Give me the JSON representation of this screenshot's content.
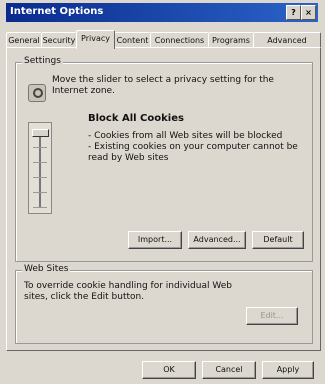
{
  "window": {
    "title": "Internet Options"
  },
  "titlebar_buttons": [
    "?",
    "×"
  ],
  "tabs": [
    "General",
    "Security",
    "Privacy",
    "Content",
    "Connections",
    "Programs",
    "Advanced"
  ],
  "active_tab": "Privacy",
  "settings": {
    "group_label": "Settings",
    "instruction": "Move the slider to select a privacy setting for the Internet zone.",
    "level_title": "Block All Cookies",
    "description_lines": [
      "- Cookies from all Web sites will be blocked",
      "- Existing cookies on your computer cannot be read by Web sites"
    ],
    "buttons": [
      "Import...",
      "Advanced...",
      "Default"
    ]
  },
  "web_sites": {
    "group_label": "Web Sites",
    "text": "To override cookie handling for individual Web sites, click the Edit button.",
    "edit_button": "Edit..."
  },
  "footer_buttons": [
    "OK",
    "Cancel",
    "Apply"
  ]
}
